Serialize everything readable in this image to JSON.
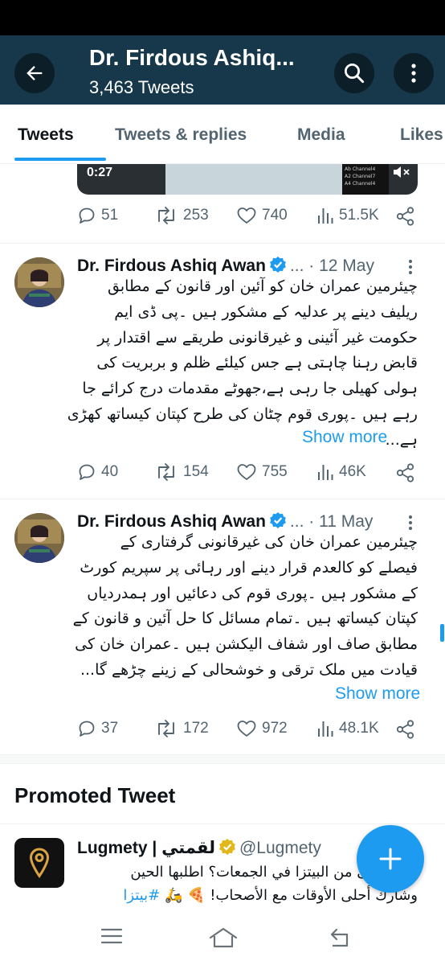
{
  "header": {
    "title": "Dr. Firdous Ashiq...",
    "tweet_count": "3,463 Tweets"
  },
  "tabs": [
    {
      "label": "Tweets",
      "active": true
    },
    {
      "label": "Tweets & replies",
      "active": false
    },
    {
      "label": "Media",
      "active": false
    },
    {
      "label": "Likes",
      "active": false
    }
  ],
  "media": {
    "duration": "0:27",
    "panel_lines": [
      "Ab Channel4",
      "A2 Channel7",
      "A4 Channel4"
    ]
  },
  "tweets": [
    {
      "stats": {
        "replies": "51",
        "retweets": "253",
        "likes": "740",
        "views": "51.5K"
      }
    },
    {
      "author": "Dr. Firdous Ashiq Awan",
      "ellipsis": "...",
      "date": "· 12 May",
      "text_lines": [
        "چیئرمین عمران خان کو آئین اور قانون کے مطابق",
        "ریلیف دینے پر عدلیہ کے مشکور ہیں ۔پی ڈی ایم",
        "حکومت غیر آئینی و غیرقانونی طریقے سے اقتدار پر",
        "قابض رہنا چاہتی ہے جس کیلئے ظلم و بربریت کی",
        "ہولی کھیلی جا رہی ہے،جھوٹے مقدمات درج کرائے جا",
        "رہے ہیں ۔پوری قوم چٹان کی طرح کپتان کیساتھ کھڑی",
        "ہے..."
      ],
      "show_more": "Show more",
      "stats": {
        "replies": "40",
        "retweets": "154",
        "likes": "755",
        "views": "46K"
      }
    },
    {
      "author": "Dr. Firdous Ashiq Awan",
      "ellipsis": "...",
      "date": "· 11 May",
      "text_lines": [
        "چیئرمین عمران خان کی غیرقانونی گرفتاری کے",
        "فیصلے کو کالعدم قرار دینے اور رہائی پر سپریم کورٹ",
        "کے مشکور ہیں ۔پوری قوم کی دعائیں اور ہمدردیاں",
        "کپتان کیساتھ ہیں ۔تمام مسائل کا حل آئین و قانون کے",
        "مطابق صاف اور شفاف الیکشن ہیں ۔عمران خان کی",
        "قیادت میں ملک ترقی و خوشحالی کے زینے چڑھے گا..."
      ],
      "show_more": "Show more",
      "stats": {
        "replies": "37",
        "retweets": "172",
        "likes": "972",
        "views": "48.1K"
      }
    }
  ],
  "promoted": {
    "section_title": "Promoted Tweet",
    "author": "Lugmety | لقمتي",
    "handle": "@Lugmety",
    "text_line1": "إيش أحلى من البيتزا في الجمعات؟ اطلبها الحين",
    "text_line2": "وشارك أحلى الأوقات مع الأصحاب! 🍕 🛵",
    "hashtag": "#بيتزا"
  },
  "colors": {
    "accent": "#1d9bf0",
    "header_bg": "#16384a",
    "secondary_text": "#536471"
  }
}
